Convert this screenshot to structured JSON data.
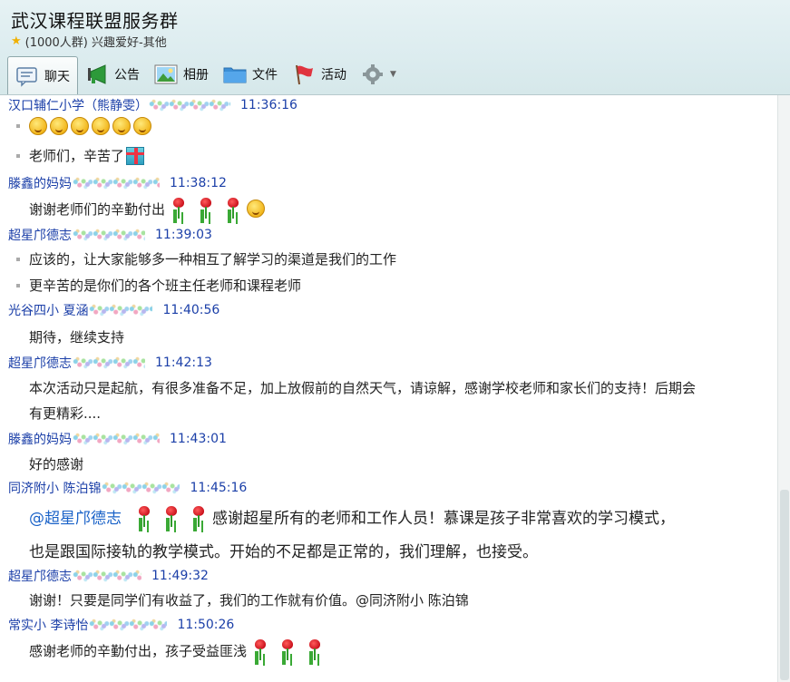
{
  "header": {
    "title": "武汉课程联盟服务群",
    "subtitle": "(1000人群) 兴趣爱好-其他"
  },
  "toolbar": {
    "items": [
      {
        "label": "聊天",
        "icon": "chat-icon"
      },
      {
        "label": "公告",
        "icon": "megaphone-icon"
      },
      {
        "label": "相册",
        "icon": "photo-icon"
      },
      {
        "label": "文件",
        "icon": "folder-icon"
      },
      {
        "label": "活动",
        "icon": "flag-icon"
      }
    ],
    "settings_icon": "gear-icon"
  },
  "messages": [
    {
      "sender": "汉口辅仁小学（熊静雯）",
      "time": "11:36:16",
      "lines": [
        "",
        "老师们，辛苦了"
      ]
    },
    {
      "sender": "滕鑫的妈妈",
      "time": "11:38:12",
      "lines": [
        "谢谢老师们的辛勤付出"
      ]
    },
    {
      "sender": "超星邝德志",
      "time": "11:39:03",
      "lines": [
        "应该的，让大家能够多一种相互了解学习的渠道是我们的工作",
        "更辛苦的是你们的各个班主任老师和课程老师"
      ]
    },
    {
      "sender": "光谷四小  夏涵",
      "time": "11:40:56",
      "lines": [
        "期待，继续支持"
      ]
    },
    {
      "sender": "超星邝德志",
      "time": "11:42:13",
      "lines": [
        "本次活动只是起航，有很多准备不足，加上放假前的自然天气，请谅解，感谢学校老师和家长们的支持！后期会",
        "有更精彩...."
      ]
    },
    {
      "sender": "滕鑫的妈妈",
      "time": "11:43:01",
      "lines": [
        "好的感谢"
      ]
    },
    {
      "sender": "同济附小 陈泊锦",
      "time": "11:45:16",
      "mention": "@超星邝德志",
      "lines": [
        "感谢超星所有的老师和工作人员！慕课是孩子非常喜欢的学习模式，",
        "也是跟国际接轨的教学模式。开始的不足都是正常的，我们理解，也接受。"
      ]
    },
    {
      "sender": "超星邝德志",
      "time": "11:49:32",
      "lines": [
        "谢谢！只要是同学们有收益了，我们的工作就有价值。@同济附小 陈泊锦"
      ]
    },
    {
      "sender": "常实小 李诗怡",
      "time": "11:50:26",
      "lines": [
        "感谢老师的辛勤付出，孩子受益匪浅"
      ]
    }
  ]
}
